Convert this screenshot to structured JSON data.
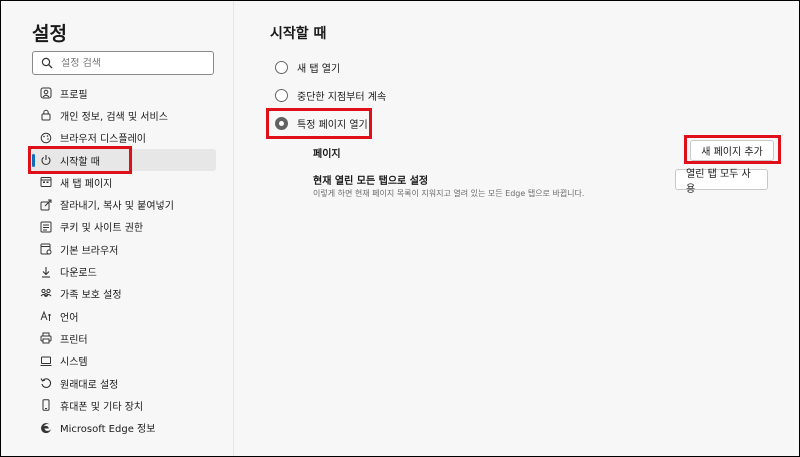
{
  "sidebar": {
    "title": "설정",
    "search_placeholder": "설정 검색",
    "items": [
      {
        "label": "프로필",
        "icon": "profile-icon"
      },
      {
        "label": "개인 정보, 검색 및 서비스",
        "icon": "lock-icon"
      },
      {
        "label": "브라우저 디스플레이",
        "icon": "appearance-icon"
      },
      {
        "label": "시작할 때",
        "icon": "power-icon",
        "active": true
      },
      {
        "label": "새 탭 페이지",
        "icon": "new-tab-icon"
      },
      {
        "label": "잘라내기, 복사 및 붙여넣기",
        "icon": "share-icon"
      },
      {
        "label": "쿠키 및 사이트 권한",
        "icon": "cookie-icon"
      },
      {
        "label": "기본 브라우저",
        "icon": "browser-icon"
      },
      {
        "label": "다운로드",
        "icon": "download-icon"
      },
      {
        "label": "가족 보호 설정",
        "icon": "family-icon"
      },
      {
        "label": "언어",
        "icon": "language-icon"
      },
      {
        "label": "프린터",
        "icon": "printer-icon"
      },
      {
        "label": "시스템",
        "icon": "system-icon"
      },
      {
        "label": "원래대로 설정",
        "icon": "reset-icon"
      },
      {
        "label": "휴대폰 및 기타 장치",
        "icon": "phone-icon"
      },
      {
        "label": "Microsoft Edge 정보",
        "icon": "edge-icon"
      }
    ]
  },
  "main": {
    "title": "시작할 때",
    "options": [
      {
        "label": "새 탭 열기",
        "checked": false
      },
      {
        "label": "중단한 지점부터 계속",
        "checked": false
      },
      {
        "label": "특정 페이지 열기",
        "checked": true
      }
    ],
    "pages_label": "페이지",
    "add_page_button": "새 페이지 추가",
    "use_open_tabs_title": "현재 열린 모든 탭으로 설정",
    "use_open_tabs_desc": "이렇게 하면 현재 페이지 목록이 지워지고 열려 있는 모든 Edge 탭으로 바뀝니다.",
    "use_all_tabs_button": "열린 탭 모두 사용"
  },
  "colors": {
    "highlight": "#e0101b",
    "accent": "#0f6cbd"
  }
}
